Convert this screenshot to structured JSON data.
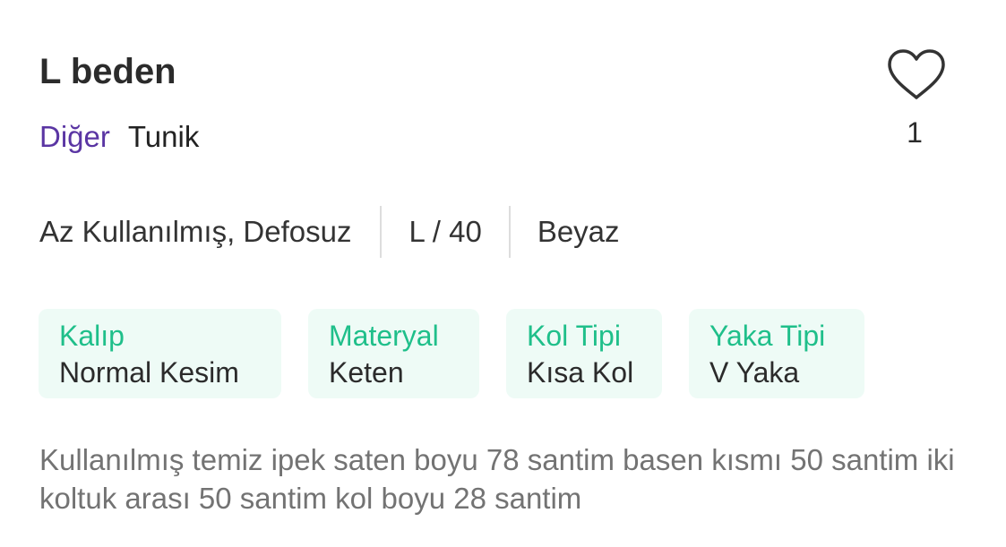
{
  "product": {
    "title": "L beden",
    "category": "Diğer",
    "subcategory": "Tunik",
    "favorites": {
      "icon": "heart-icon",
      "count": "1"
    },
    "condition": "Az Kullanılmış, Defosuz",
    "size": "L / 40",
    "color": "Beyaz",
    "attributes": [
      {
        "label": "Kalıp",
        "value": "Normal Kesim"
      },
      {
        "label": "Materyal",
        "value": "Keten"
      },
      {
        "label": "Kol Tipi",
        "value": "Kısa Kol"
      },
      {
        "label": "Yaka Tipi",
        "value": "V Yaka"
      }
    ],
    "description": "Kullanılmış temiz ipek saten boyu 78 santim basen kısmı 50 santim iki koltuk arası 50 santim kol boyu 28 santim"
  },
  "theme": {
    "category_color": "#5a35a3",
    "attribute_label_color": "#1fbf8a",
    "attribute_bg": "#eefbf6",
    "description_color": "#737373"
  }
}
